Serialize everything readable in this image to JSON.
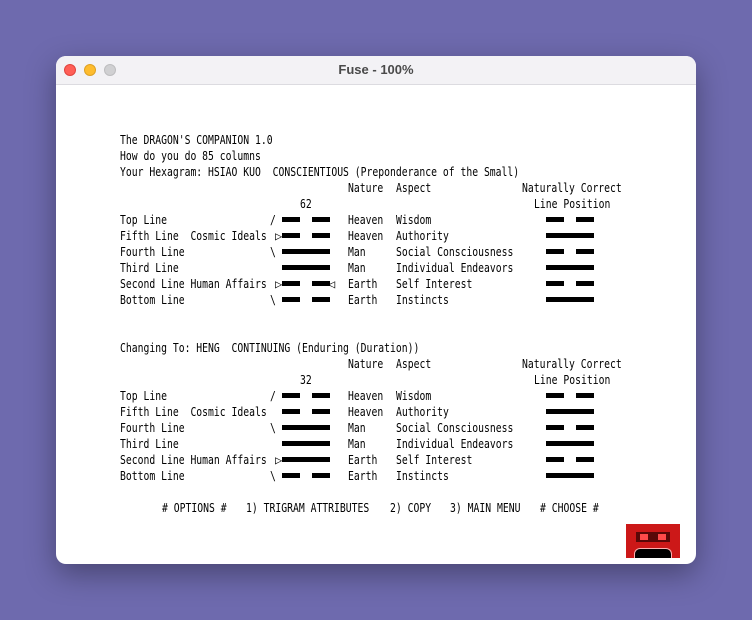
{
  "window": {
    "title": "Fuse - 100%"
  },
  "header": {
    "line1": "The DRAGON'S COMPANION 1.0",
    "line2": "How do you do 85 columns",
    "line3": "Your Hexagram: HSIAO KUO  CONSCIENTIOUS (Preponderance of the Small)"
  },
  "column_labels": {
    "nature": "Nature",
    "aspect": "Aspect",
    "correct1": "Naturally Correct",
    "correct2": "Line Position"
  },
  "hex1": {
    "number": "62",
    "rows": [
      {
        "label": "Top Line",
        "mark": "/",
        "yin": true,
        "moving": "",
        "nature": "Heaven",
        "aspect": "Wisdom",
        "correct_yin": true
      },
      {
        "label": "Fifth Line  Cosmic Ideals",
        "mark": "",
        "yin": true,
        "moving": "left",
        "nature": "Heaven",
        "aspect": "Authority",
        "correct_yin": false
      },
      {
        "label": "Fourth Line",
        "mark": "\\",
        "yin": false,
        "moving": "",
        "nature": "Man",
        "aspect": "Social Consciousness",
        "correct_yin": true
      },
      {
        "label": "Third Line",
        "mark": "",
        "yin": false,
        "moving": "",
        "nature": "Man",
        "aspect": "Individual Endeavors",
        "correct_yin": false
      },
      {
        "label": "Second Line Human Affairs",
        "mark": "",
        "yin": true,
        "moving": "both",
        "nature": "Earth",
        "aspect": "Self Interest",
        "correct_yin": true
      },
      {
        "label": "Bottom Line",
        "mark": "\\",
        "yin": true,
        "moving": "",
        "nature": "Earth",
        "aspect": "Instincts",
        "correct_yin": false
      }
    ]
  },
  "changing_to": "Changing To: HENG  CONTINUING (Enduring (Duration))",
  "hex2": {
    "number": "32",
    "rows": [
      {
        "label": "Top Line",
        "mark": "/",
        "yin": true,
        "moving": "",
        "nature": "Heaven",
        "aspect": "Wisdom",
        "correct_yin": true
      },
      {
        "label": "Fifth Line  Cosmic Ideals",
        "mark": "",
        "yin": true,
        "moving": "",
        "nature": "Heaven",
        "aspect": "Authority",
        "correct_yin": false
      },
      {
        "label": "Fourth Line",
        "mark": "\\",
        "yin": false,
        "moving": "",
        "nature": "Man",
        "aspect": "Social Consciousness",
        "correct_yin": true
      },
      {
        "label": "Third Line",
        "mark": "",
        "yin": false,
        "moving": "",
        "nature": "Man",
        "aspect": "Individual Endeavors",
        "correct_yin": false
      },
      {
        "label": "Second Line Human Affairs",
        "mark": "",
        "yin": false,
        "moving": "left",
        "nature": "Earth",
        "aspect": "Self Interest",
        "correct_yin": true
      },
      {
        "label": "Bottom Line",
        "mark": "\\",
        "yin": true,
        "moving": "",
        "nature": "Earth",
        "aspect": "Instincts",
        "correct_yin": false
      }
    ]
  },
  "menu": {
    "options": "# OPTIONS #",
    "item1": "1) TRIGRAM ATTRIBUTES",
    "item2": "2) COPY",
    "item3": "3) MAIN MENU",
    "choose": "# CHOOSE #"
  },
  "icons": {
    "status": "robot-icon",
    "close": "close-icon",
    "minimize": "minimize-icon",
    "zoom": "zoom-icon",
    "moving_line": "moving-line-marker-icon"
  },
  "colors": {
    "desktop": "#6e6aae",
    "close": "#ff5f57",
    "minimize": "#febc2e",
    "zoom_disabled": "#d0d0d2",
    "robot_red": "#cc1818"
  }
}
